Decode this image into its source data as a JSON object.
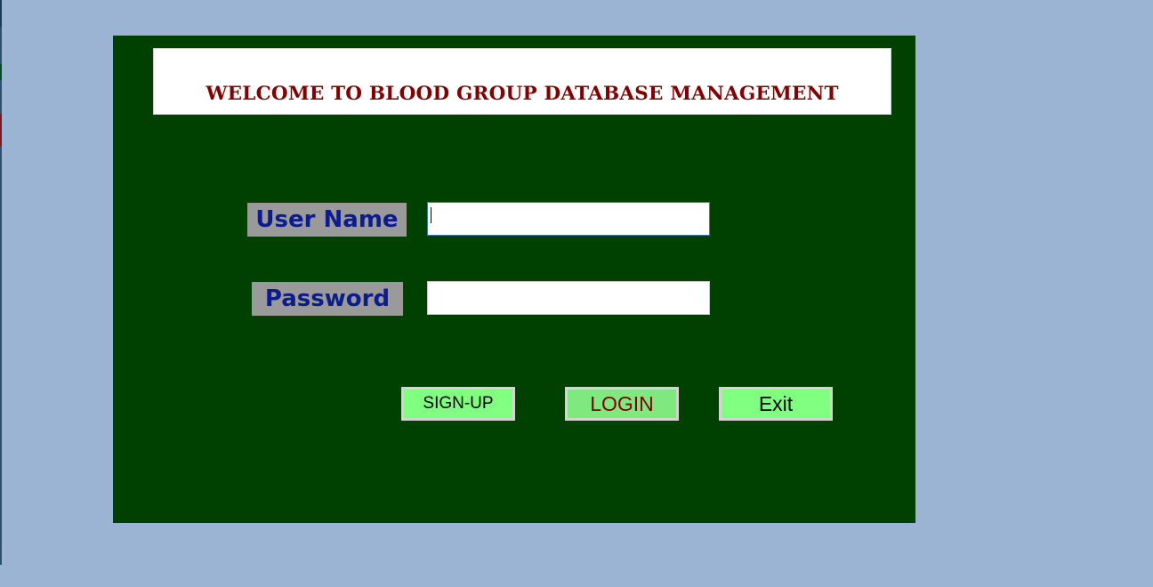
{
  "window": {
    "background_color": "#9bb4d3"
  },
  "panel": {
    "background_color": "#004000"
  },
  "title": {
    "text": "WELCOME TO BLOOD GROUP DATABASE MANAGEMENT",
    "color": "#800000"
  },
  "form": {
    "username_label": "User Name",
    "password_label": "Password",
    "username_value": "",
    "password_value": "",
    "label_color": "#0c1c8c",
    "label_background": "#9a9a9a"
  },
  "buttons": {
    "signup_label": "SIGN-UP",
    "login_label": "LOGIN",
    "exit_label": "Exit",
    "button_color": "#80ff80"
  }
}
